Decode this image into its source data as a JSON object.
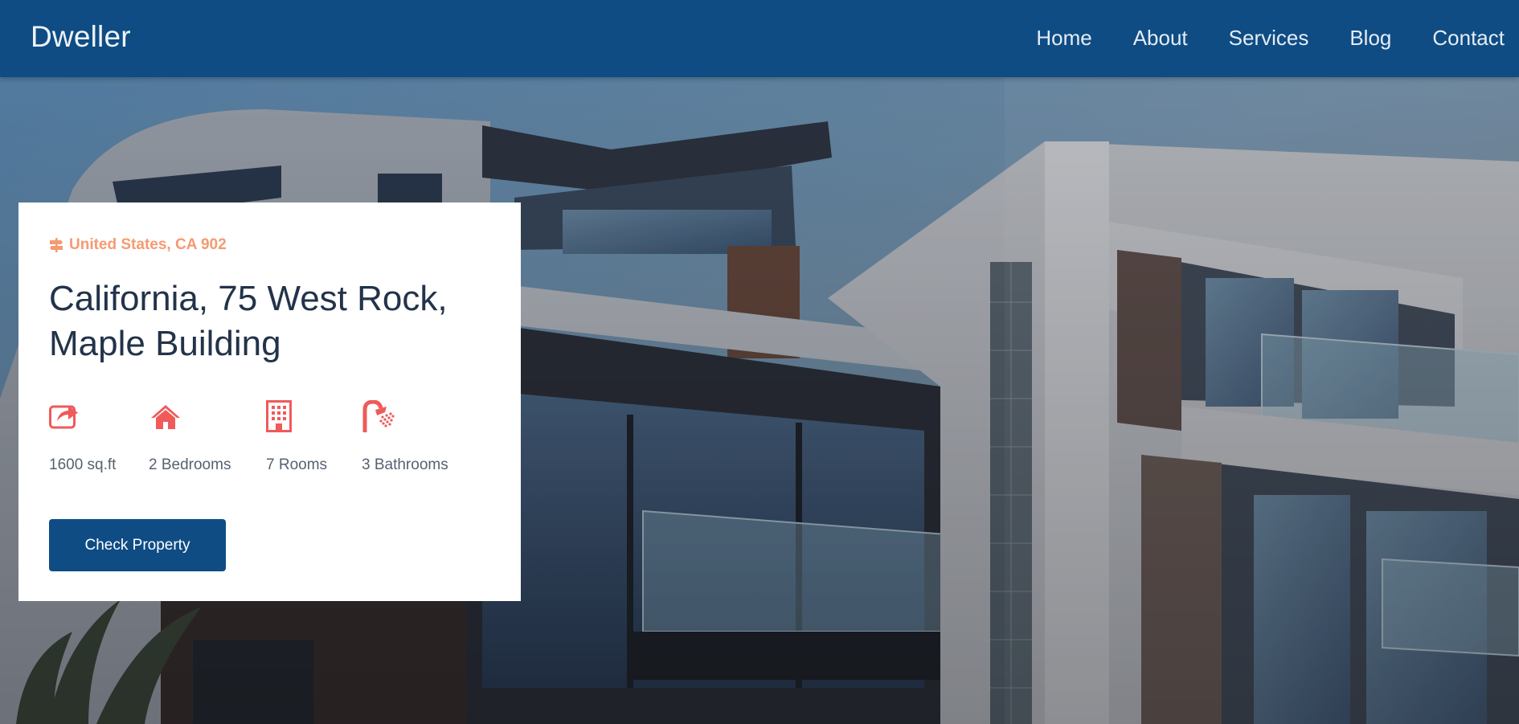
{
  "brand": "Dweller",
  "nav": {
    "items": [
      "Home",
      "About",
      "Services",
      "Blog",
      "Contact"
    ]
  },
  "card": {
    "location": "United States, CA 902",
    "title_line1": "California, 75 West Rock,",
    "title_line2": "Maple Building",
    "features": [
      {
        "icon": "share-icon",
        "label": "1600 sq.ft"
      },
      {
        "icon": "home-icon",
        "label": "2 Bedrooms"
      },
      {
        "icon": "building-icon",
        "label": "7 Rooms"
      },
      {
        "icon": "shower-icon",
        "label": "3 Bathrooms"
      }
    ],
    "button_label": "Check Property"
  },
  "colors": {
    "navbar": "#0f4c84",
    "accent": "#f05a5a",
    "location": "#f59a72",
    "title": "#22334a",
    "button": "#0f4c84"
  }
}
